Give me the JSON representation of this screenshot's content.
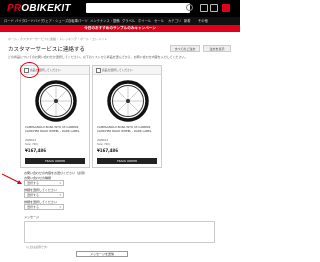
{
  "header": {
    "logo_text": "BIKEKIT",
    "logo_mark": "PR",
    "logo_dot": "O",
    "search_placeholder": "",
    "icons": [
      "search-icon",
      "account-icon",
      "wishlist-icon",
      "cart-icon"
    ]
  },
  "nav": {
    "items": [
      "ロード バイク",
      "ロードバイク",
      "ウェア・シューズ",
      "自転車パーツ",
      "メンテナンス・整備",
      "グラベル",
      "ホイール",
      "セール",
      "カテゴリ",
      "新着",
      "その他"
    ]
  },
  "promo": {
    "text": "今日のおすすめのサンプルのみキャンペーン"
  },
  "breadcrumb": "ホーム › カスタマーサービスに連絡 › トレッキング・ポール・エレメント",
  "page": {
    "title": "カスタマーサービスに連絡する",
    "btn_orders": "すべてのご注文",
    "btn_view": "注文を表示",
    "instruction": "どの商品についてのお問い合わせか選択してください。以下のリストから商品を選んでから、お問い合わせ内容を入力してください。"
  },
  "products": [
    {
      "head_label": "商品を選択してください",
      "name": "CAMPAGNOLO BORA WTO 45 CARBON CLINCHER ROAD WHEEL - DARK LABEL",
      "meta1": "2WBR12",
      "meta2": "Size: 700c",
      "price": "¥167,486",
      "button": "TRACK ORDER"
    },
    {
      "head_label": "商品を選択してください",
      "name": "CAMPAGNOLO BORA WTO 45 CARBON CLINCHER ROAD WHEEL - DARK LABEL",
      "meta1": "2WBR12",
      "meta2": "Size: 700c",
      "price": "¥167,486",
      "button": "TRACK ORDER"
    }
  ],
  "form": {
    "question_label": "お問い合わせの内容をお選びください（必須）",
    "q1_label": "お問い合わせの種類",
    "q1_value": "選択する",
    "q2_label": "詳細を選択してください",
    "q2_value": "選択する",
    "q3_label": "詳細を選択してください",
    "q3_value": "選択する",
    "message_label": "メッセージ",
    "note": "（入力は必須です）",
    "submit": "メッセージを送信"
  },
  "colors": {
    "brand_red": "#e0001b",
    "header_bg": "#000000"
  }
}
